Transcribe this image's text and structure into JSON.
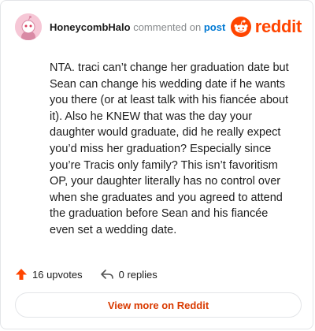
{
  "comment": {
    "author": "HoneycombHalo",
    "action_text": "commented on",
    "post_link_text": "post",
    "body": "NTA. traci can’t change her graduation date but Sean can change his wedding date if he wants you there (or at least talk with his fiancée about it). Also he KNEW that was the day your daughter would graduate, did he really expect you’d miss her graduation? Especially since you’re Tracis only family? This isn’t favoritism OP, your daughter literally has no control over when she graduates and you agreed to attend the graduation before Sean and his fiancée even set a wedding date."
  },
  "brand": {
    "name": "reddit",
    "color": "#ff4500",
    "icon": "reddit-logo-icon"
  },
  "stats": {
    "upvotes": "16 upvotes",
    "replies": "0 replies"
  },
  "actions": {
    "view_more": "View more on Reddit"
  }
}
